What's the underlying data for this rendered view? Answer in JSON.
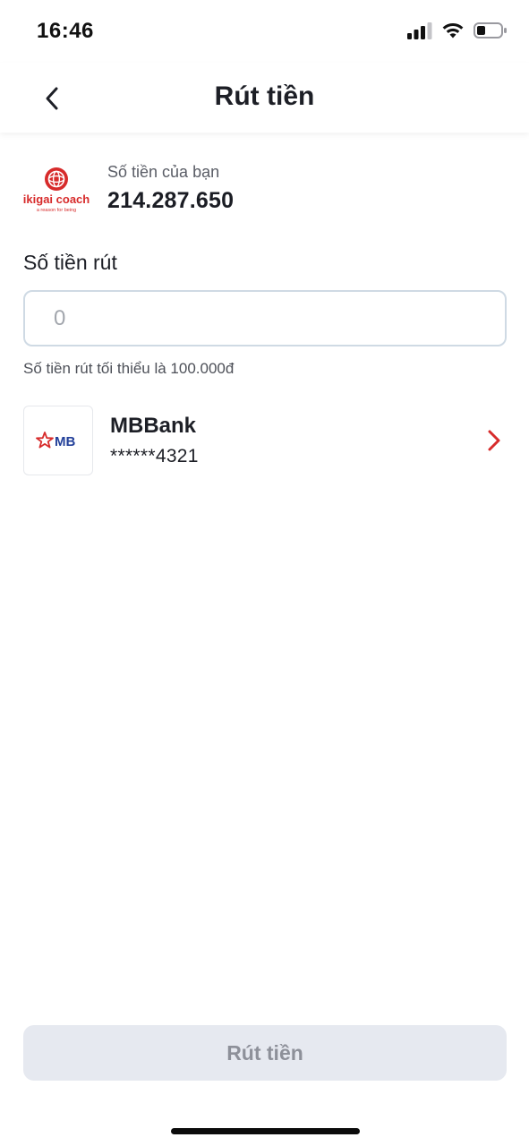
{
  "status_bar": {
    "time": "16:46",
    "icons": [
      "cellular-signal-icon",
      "wifi-icon",
      "battery-icon"
    ]
  },
  "header": {
    "title": "Rút tiền",
    "back_icon": "chevron-left-icon"
  },
  "wallet": {
    "logo_text": "ikigai coach",
    "logo_tagline": "a reason for being",
    "label": "Số tiền của bạn",
    "balance": "214.287.650"
  },
  "withdraw": {
    "label": "Số tiền rút",
    "placeholder": "0",
    "value": "",
    "min_note": "Số tiền rút tối thiểu là 100.000đ"
  },
  "bank": {
    "logo_text": "MB",
    "name": "MBBank",
    "account": "******4321",
    "chevron_icon": "chevron-right-icon"
  },
  "submit": {
    "label": "Rút tiền",
    "enabled": false
  },
  "colors": {
    "accent_red": "#d72b2b",
    "mb_blue": "#23409a",
    "button_disabled_bg": "#e6e9f0",
    "button_disabled_text": "#8d9099",
    "input_border": "#cfdae4"
  }
}
